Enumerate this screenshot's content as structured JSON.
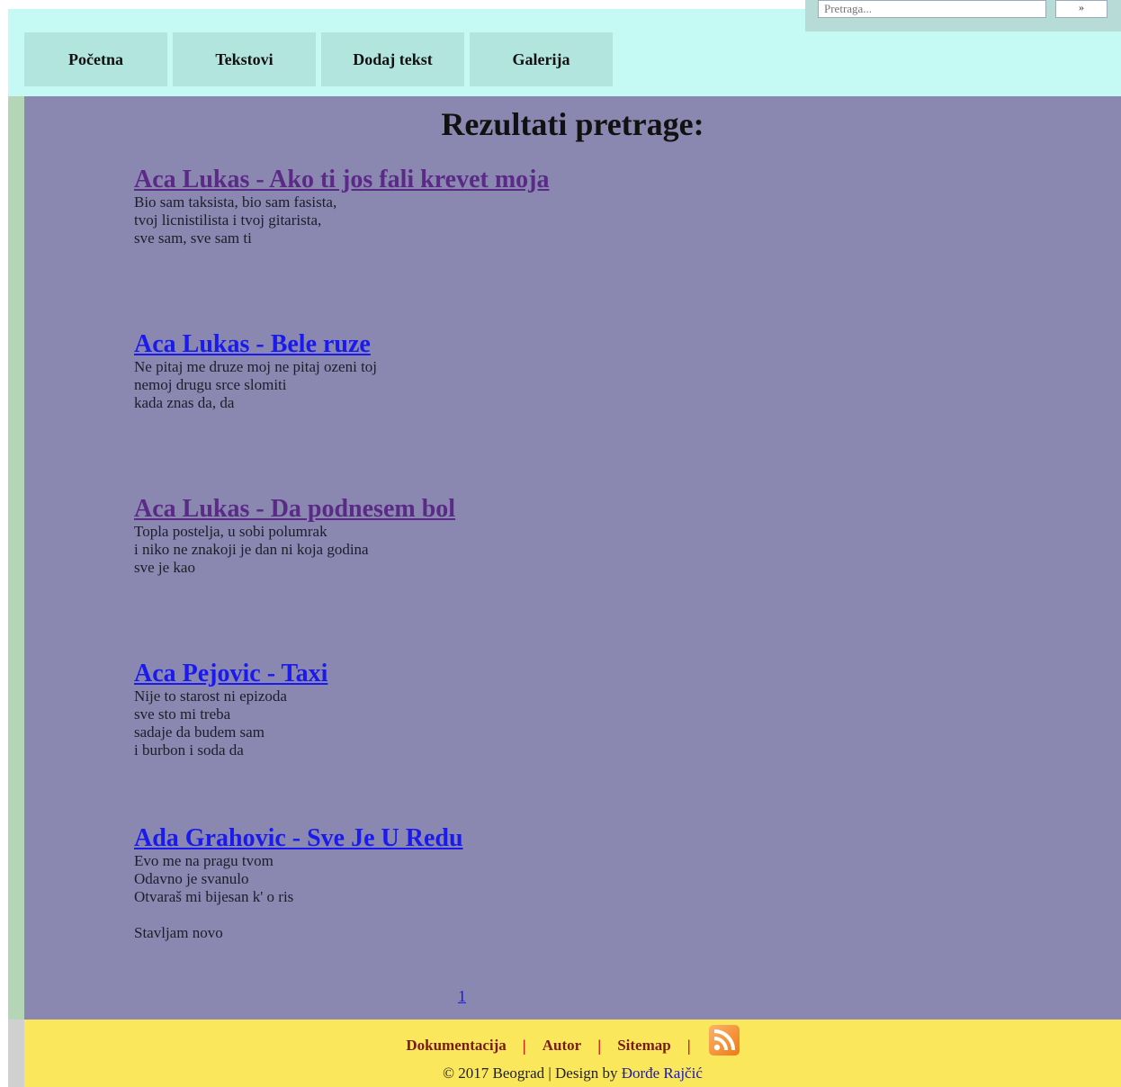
{
  "search": {
    "placeholder": "Pretraga...",
    "button_label": "»"
  },
  "nav": [
    {
      "label": "Početna"
    },
    {
      "label": "Tekstovi"
    },
    {
      "label": "Dodaj tekst"
    },
    {
      "label": "Galerija"
    }
  ],
  "page_title": "Rezultati pretrage:",
  "results": [
    {
      "title": "Aca Lukas - Ako ti jos fali krevet moja",
      "visited": true,
      "excerpt": "Bio sam taksista, bio sam fasista,\ntvoj licnistilista i tvoj gitarista,\nsve sam, sve sam ti"
    },
    {
      "title": "Aca Lukas - Bele ruze",
      "visited": false,
      "excerpt": "Ne pitaj me druze moj ne pitaj ozeni toj\nnemoj drugu srce slomiti\nkada znas da, da"
    },
    {
      "title": "Aca Lukas - Da podnesem bol",
      "visited": true,
      "excerpt": "Topla postelja, u sobi polumrak\ni niko ne znakoji je dan ni koja godina\nsve je kao"
    },
    {
      "title": "Aca Pejovic - Taxi",
      "visited": false,
      "excerpt": "Nije to starost ni epizoda\nsve sto mi treba\nsadaje da budem sam\ni burbon i soda da"
    },
    {
      "title": "Ada Grahovic - Sve Je U Redu",
      "visited": false,
      "excerpt": "Evo me na pragu tvom\nOdavno je svanulo\nOtvaraš mi bijesan k' o ris\n\nStavljam novo"
    }
  ],
  "pagination": "1",
  "footer": {
    "links": [
      "Dokumentacija",
      "Autor",
      "Sitemap"
    ],
    "separator": "|",
    "rss_icon": "rss-feed-icon",
    "copyright_prefix": "© 2017 Beograd | Design by ",
    "author": "Đorđe Rajčić"
  },
  "colors": {
    "header_bg": "#c5f9f3",
    "nav_item_bg": "#b3e5df",
    "content_bg": "#8a88b0",
    "footer_bg": "#fae75c",
    "visited_link": "#5b2a86",
    "link": "#1a1aee"
  }
}
